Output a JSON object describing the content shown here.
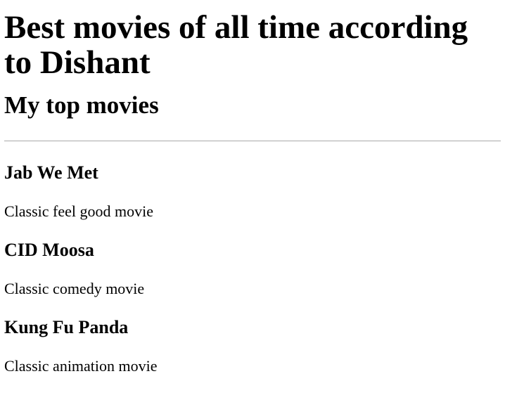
{
  "page": {
    "title": "Best movies of all time according to Dishant",
    "subtitle": "My top movies",
    "movies": [
      {
        "title": "Jab We Met",
        "description": "Classic feel good movie"
      },
      {
        "title": "CID Moosa",
        "description": "Classic comedy movie"
      },
      {
        "title": "Kung Fu Panda",
        "description": "Classic animation movie"
      }
    ]
  }
}
